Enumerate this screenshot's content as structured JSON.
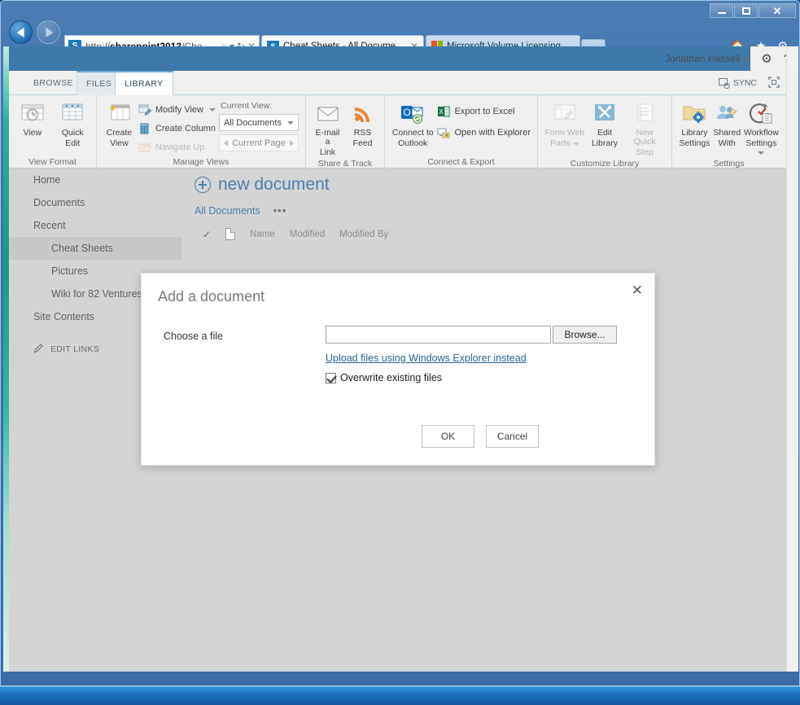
{
  "window": {
    "controls": {
      "minimize": "minimize-button",
      "maximize": "maximize-button",
      "close": "✕"
    }
  },
  "browser": {
    "address": {
      "protocol": "http://",
      "host": "sharepoint2013",
      "path": "/Che",
      "full": "http://sharepoint2013/Che"
    },
    "address_icons": {
      "search": "⌕",
      "caret": "▾",
      "refresh": "↻",
      "stop": "✕"
    },
    "tabs": [
      {
        "label": "Cheat Sheets - All Docume...",
        "active": true,
        "favicon": "sharepoint-logo",
        "close": "✕"
      },
      {
        "label": "Microsoft Volume Licensing H...",
        "active": false,
        "favicon": "microsoft-logo"
      }
    ],
    "right_icons": [
      "home-icon",
      "favorites-star-icon",
      "settings-gear-icon"
    ]
  },
  "suitebar": {
    "user_name": "Jonathan Hassell",
    "gear": "⚙",
    "help": "?"
  },
  "ribbon": {
    "tabs": [
      {
        "label": "BROWSE",
        "active": false
      },
      {
        "label": "FILES",
        "active": false
      },
      {
        "label": "LIBRARY",
        "active": true
      }
    ],
    "right": {
      "sync_label": "SYNC",
      "focus_label": "focus-on-content-icon"
    },
    "groups": [
      {
        "title": "View Format",
        "buttons": [
          {
            "label": "View",
            "icon": "view-icon"
          },
          {
            "label": "Quick\nEdit",
            "label_line1": "Quick",
            "label_line2": "Edit",
            "icon": "quick-edit-icon"
          }
        ]
      },
      {
        "title": "Manage Views",
        "big": [
          {
            "label_line1": "Create",
            "label_line2": "View",
            "icon": "create-view-icon"
          }
        ],
        "small": [
          {
            "label": "Modify View",
            "icon": "modify-view-icon",
            "has_caret": true,
            "disabled": false
          },
          {
            "label": "Create Column",
            "icon": "create-column-icon",
            "disabled": false
          },
          {
            "label": "Navigate Up",
            "icon": "navigate-up-icon",
            "disabled": true
          }
        ],
        "current_view_label": "Current View:",
        "current_view_value": "All Documents",
        "pager_value": "Current Page"
      },
      {
        "title": "Share & Track",
        "big": [
          {
            "label_line1": "E-mail a",
            "label_line2": "Link",
            "icon": "email-link-icon"
          },
          {
            "label_line1": "RSS",
            "label_line2": "Feed",
            "icon": "rss-feed-icon"
          }
        ]
      },
      {
        "title": "Connect & Export",
        "big": [
          {
            "label_line1": "Connect to",
            "label_line2": "Outlook",
            "icon": "connect-outlook-icon"
          }
        ],
        "small": [
          {
            "label": "Export to Excel",
            "icon": "export-excel-icon"
          },
          {
            "label": "Open with Explorer",
            "icon": "open-explorer-icon"
          }
        ]
      },
      {
        "title": "Customize Library",
        "big": [
          {
            "label_line1": "Form Web",
            "label_line2": "Parts",
            "icon": "form-web-parts-icon",
            "has_caret": true,
            "disabled": true
          },
          {
            "label_line1": "Edit",
            "label_line2": "Library",
            "icon": "edit-library-icon"
          },
          {
            "label_line1": "New Quick",
            "label_line2": "Step",
            "icon": "new-quick-step-icon",
            "disabled": true
          }
        ]
      },
      {
        "title": "Settings",
        "big": [
          {
            "label_line1": "Library",
            "label_line2": "Settings",
            "icon": "library-settings-icon"
          },
          {
            "label_line1": "Shared",
            "label_line2": "With",
            "icon": "shared-with-icon"
          },
          {
            "label_line1": "Workflow",
            "label_line2": "Settings",
            "icon": "workflow-settings-icon",
            "has_caret": true
          }
        ]
      }
    ]
  },
  "sidebar": {
    "items": [
      {
        "label": "Home",
        "level": 0,
        "selected": false
      },
      {
        "label": "Documents",
        "level": 0,
        "selected": false
      },
      {
        "label": "Recent",
        "level": 0,
        "selected": false
      },
      {
        "label": "Cheat Sheets",
        "level": 1,
        "selected": true
      },
      {
        "label": "Pictures",
        "level": 1,
        "selected": false
      },
      {
        "label": "Wiki for 82 Ventures",
        "level": 1,
        "selected": false
      },
      {
        "label": "Site Contents",
        "level": 0,
        "selected": false
      }
    ],
    "edit_links": {
      "label": "EDIT LINKS",
      "icon": "pencil-icon"
    }
  },
  "content": {
    "new_document": "new document",
    "view_link": "All Documents",
    "ellipsis": "•••",
    "columns": [
      "Name",
      "Modified",
      "Modified By"
    ]
  },
  "dialog": {
    "title": "Add a document",
    "close": "✕",
    "label": "Choose a file",
    "file_value": "",
    "file_placeholder": "",
    "browse_label": "Browse...",
    "explorer_link": "Upload files using Windows Explorer instead",
    "overwrite_label": "Overwrite existing files",
    "overwrite_checked": true,
    "ok_label": "OK",
    "cancel_label": "Cancel"
  },
  "colors": {
    "suitebar": "#3d7aab",
    "accent_link": "#4b7fae",
    "left_stripe": "#0f9f85",
    "ribbon_bg": "#efefef",
    "page_bg": "#d4d4d4",
    "taskbar": "#1b6fba"
  }
}
